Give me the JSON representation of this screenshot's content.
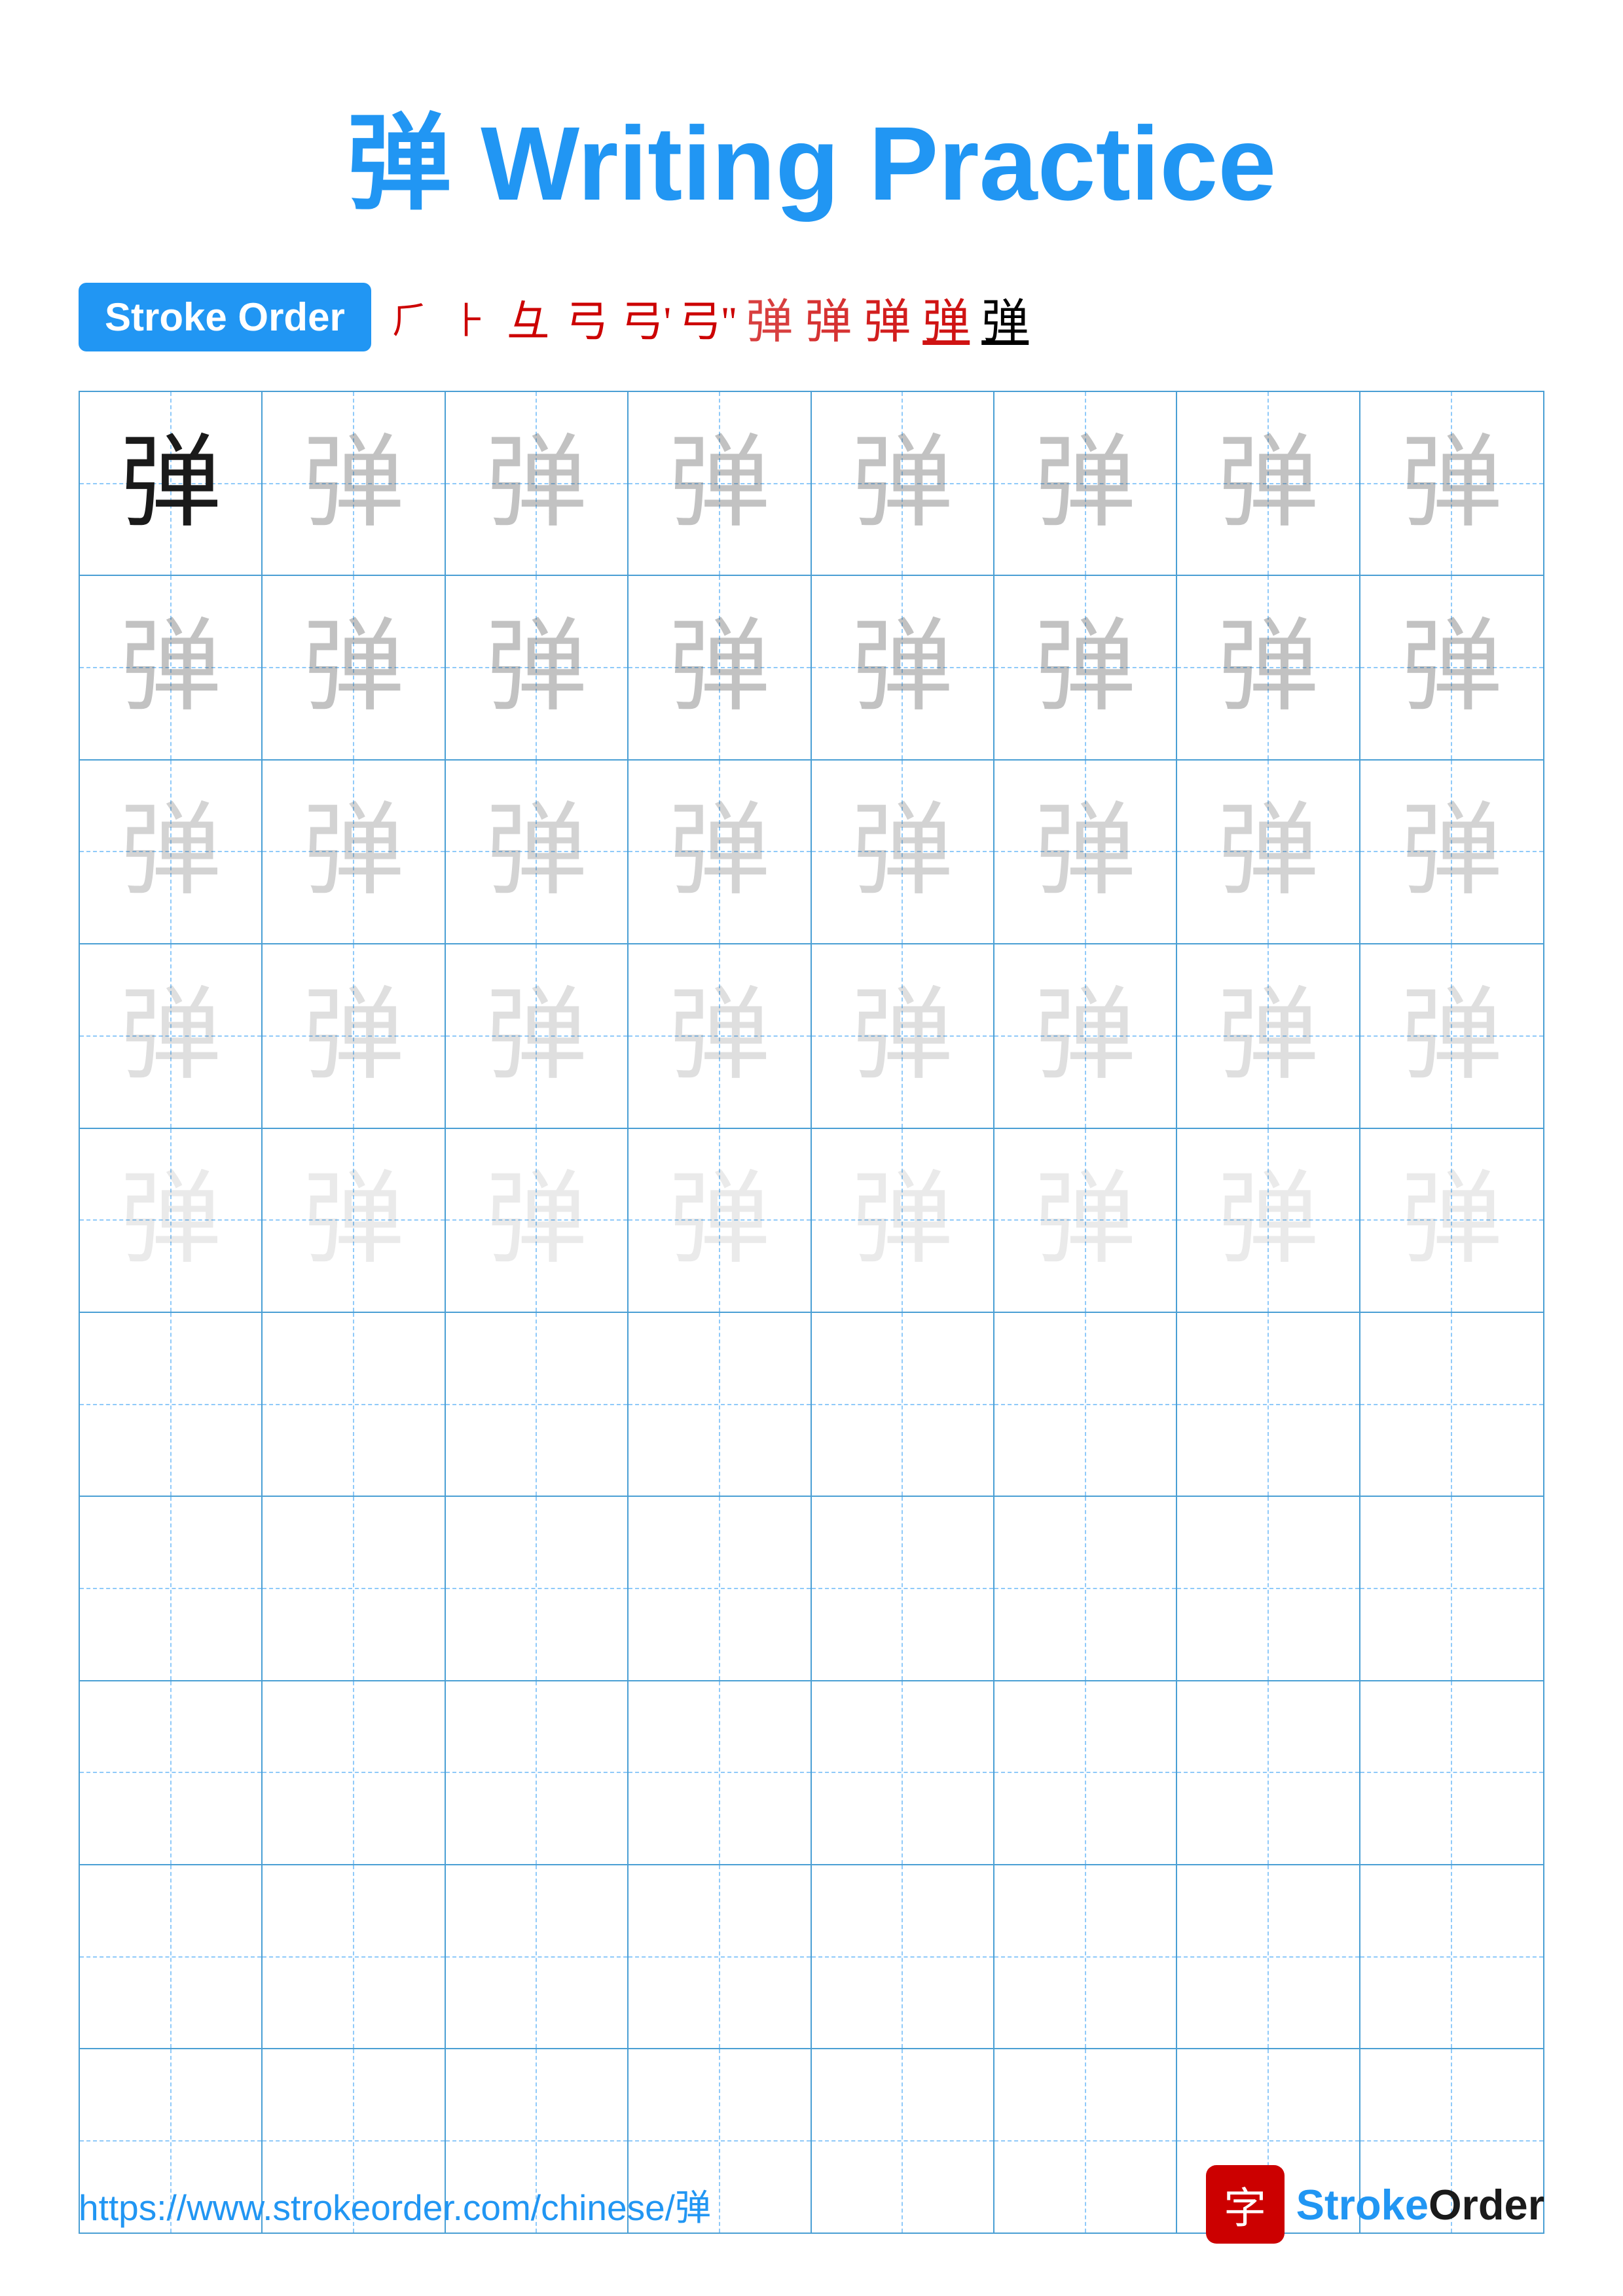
{
  "title": {
    "char": "弹",
    "text": " Writing Practice"
  },
  "stroke_order": {
    "badge_label": "Stroke Order",
    "steps": [
      "㇆",
      "㇆",
      "彐",
      "弓`",
      "弓`'",
      "弓`''",
      "弹0",
      "弹1",
      "弹2",
      "弹3",
      "弹"
    ]
  },
  "grid": {
    "character": "弹",
    "rows": 10,
    "cols": 8,
    "practice_rows": 5,
    "empty_rows": 5
  },
  "footer": {
    "url": "https://www.strokeorder.com/chinese/弹",
    "logo_char": "字",
    "logo_text": "StrokeOrder"
  }
}
